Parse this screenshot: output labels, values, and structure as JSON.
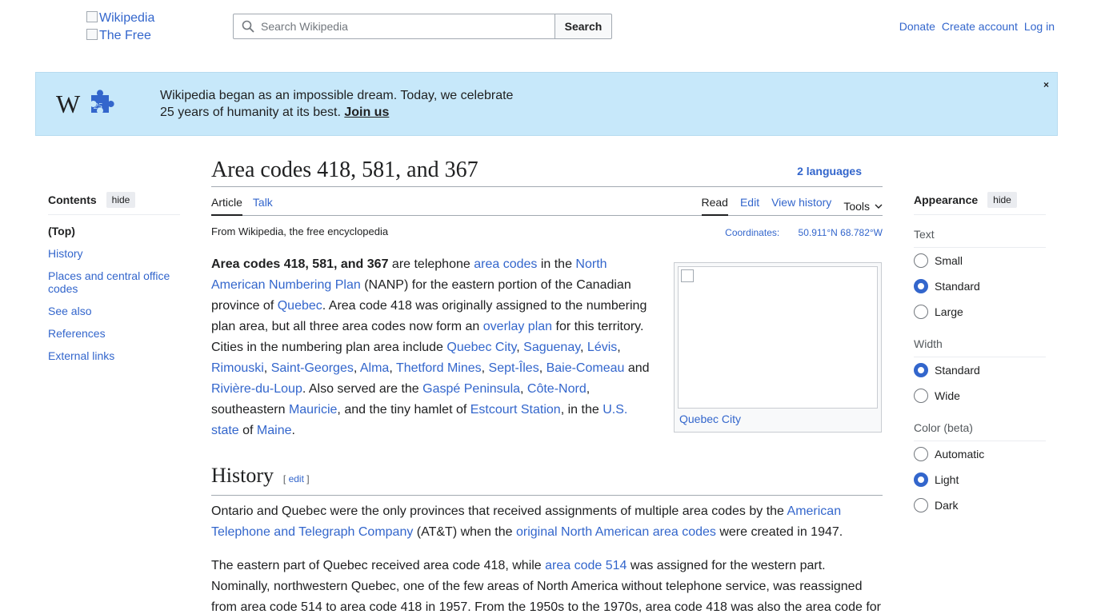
{
  "header": {
    "logo_alt": "Wikipedia",
    "logo_alt2": "The Free",
    "search_placeholder": "Search Wikipedia",
    "search_button": "Search",
    "links": [
      "Donate",
      "Create account",
      "Log in"
    ]
  },
  "banner": {
    "line1": "Wikipedia began as an impossible dream. Today, we celebrate",
    "line2": "25 years of humanity at its best.",
    "cta": "Join us",
    "close": "×"
  },
  "toc": {
    "title": "Contents",
    "hide": "hide",
    "items": [
      "(Top)",
      "History",
      "Places and central office codes",
      "See also",
      "References",
      "External links"
    ]
  },
  "article": {
    "title": "Area codes 418, 581, and 367",
    "languages": "2 languages",
    "tabs_left": [
      "Article",
      "Talk"
    ],
    "tabs_right": [
      "Read",
      "Edit",
      "View history",
      "Tools"
    ],
    "tagline": "From Wikipedia, the free encyclopedia",
    "coords_label": "Coordinates:",
    "coords_value": "50.911°N 68.782°W",
    "infobox_caption": "Quebec City",
    "history_heading": "History",
    "edit_link": "edit"
  },
  "appearance": {
    "title": "Appearance",
    "hide": "hide",
    "text_label": "Text",
    "text_options": [
      "Small",
      "Standard",
      "Large"
    ],
    "text_selected": "Standard",
    "width_label": "Width",
    "width_options": [
      "Standard",
      "Wide"
    ],
    "width_selected": "Standard",
    "color_label": "Color (beta)",
    "color_options": [
      "Automatic",
      "Light",
      "Dark"
    ],
    "color_selected": "Light"
  }
}
